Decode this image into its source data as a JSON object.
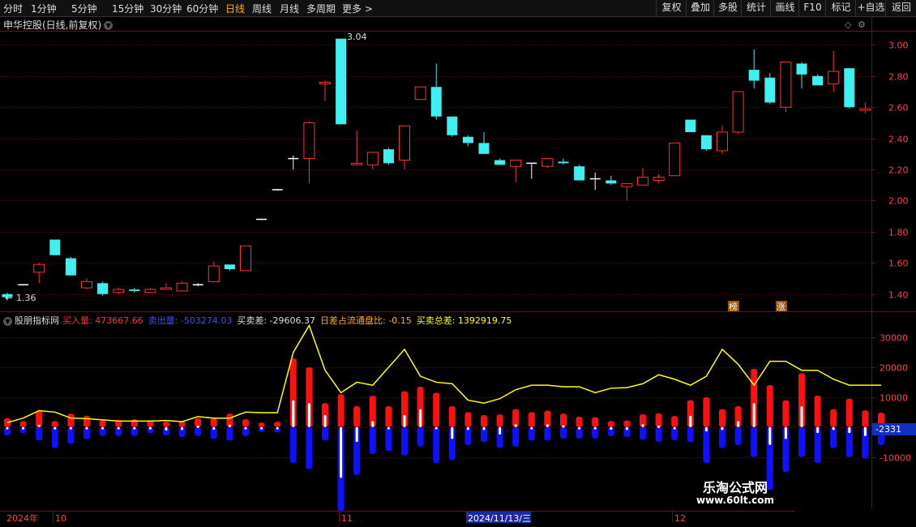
{
  "toolbar": {
    "periods": [
      "分时",
      "1分钟",
      "5分钟",
      "15分钟",
      "30分钟",
      "60分钟",
      "日线",
      "周线",
      "月线",
      "多周期",
      "更多 >"
    ],
    "active_period": "日线",
    "right_buttons": [
      "复权",
      "叠加",
      "多股",
      "统计",
      "画线",
      "F10",
      "标记",
      "+自选",
      "返回"
    ]
  },
  "price_panel": {
    "title": "申华控股(日线,前复权)",
    "high_label": "3.04",
    "low_label": "1.36",
    "low_arrow": "←",
    "markers": [
      "榜",
      "涨"
    ]
  },
  "indicator_panel": {
    "name": "股朋指标网",
    "items": [
      {
        "label": "买入量:",
        "value": "473667.66",
        "color": "#ff3030"
      },
      {
        "label": "卖出量:",
        "value": "-503274.03",
        "color": "#3050ff"
      },
      {
        "label": "买卖差:",
        "value": "-29606.37",
        "color": "#dddddd"
      },
      {
        "label": "日差占流通盘比:",
        "value": "-0.15",
        "color": "#ffb000"
      },
      {
        "label": "买卖总差:",
        "value": "1392919.75",
        "color": "#ffff00"
      }
    ],
    "current_value_label": "-2331"
  },
  "date_axis": {
    "labels": [
      "2024年",
      "10",
      "11",
      "2024/11/13/三",
      "12"
    ]
  },
  "watermark": {
    "line1": "乐淘公式网",
    "line2": "www.60lt.com"
  },
  "chart_data": [
    {
      "type": "candlestick",
      "title": "申华控股(日线,前复权)",
      "y_ticks": [
        3.0,
        2.8,
        2.6,
        2.4,
        2.2,
        2.0,
        1.8,
        1.6,
        1.4
      ],
      "ylim": [
        1.31,
        3.08
      ],
      "candles": [
        [
          1.4,
          1.38,
          1.41,
          1.36
        ],
        [
          1.46,
          1.46,
          1.46,
          1.46
        ],
        [
          1.54,
          1.59,
          1.6,
          1.47
        ],
        [
          1.75,
          1.65,
          1.75,
          1.65
        ],
        [
          1.63,
          1.52,
          1.64,
          1.52
        ],
        [
          1.44,
          1.48,
          1.5,
          1.43
        ],
        [
          1.47,
          1.4,
          1.48,
          1.39
        ],
        [
          1.41,
          1.43,
          1.44,
          1.4
        ],
        [
          1.43,
          1.42,
          1.44,
          1.41
        ],
        [
          1.41,
          1.43,
          1.44,
          1.41
        ],
        [
          1.43,
          1.44,
          1.47,
          1.43
        ],
        [
          1.42,
          1.47,
          1.48,
          1.42
        ],
        [
          1.46,
          1.46,
          1.47,
          1.45
        ],
        [
          1.48,
          1.58,
          1.61,
          1.48
        ],
        [
          1.59,
          1.56,
          1.59,
          1.55
        ],
        [
          1.55,
          1.71,
          1.71,
          1.55
        ],
        [
          1.88,
          1.88,
          1.88,
          1.88
        ],
        [
          2.07,
          2.07,
          2.07,
          2.07
        ],
        [
          2.27,
          2.27,
          2.29,
          2.2
        ],
        [
          2.27,
          2.5,
          2.51,
          2.11
        ],
        [
          2.75,
          2.76,
          2.77,
          2.64
        ],
        [
          3.04,
          2.49,
          3.04,
          2.49
        ],
        [
          2.23,
          2.24,
          2.45,
          2.23
        ],
        [
          2.23,
          2.31,
          2.31,
          2.2
        ],
        [
          2.33,
          2.24,
          2.34,
          2.23
        ],
        [
          2.26,
          2.48,
          2.48,
          2.2
        ],
        [
          2.65,
          2.73,
          2.73,
          2.65
        ],
        [
          2.73,
          2.54,
          2.88,
          2.52
        ],
        [
          2.54,
          2.42,
          2.54,
          2.41
        ],
        [
          2.41,
          2.37,
          2.42,
          2.35
        ],
        [
          2.37,
          2.3,
          2.44,
          2.3
        ],
        [
          2.26,
          2.23,
          2.27,
          2.23
        ],
        [
          2.22,
          2.26,
          2.26,
          2.12
        ],
        [
          2.24,
          2.24,
          2.24,
          2.14
        ],
        [
          2.22,
          2.27,
          2.27,
          2.21
        ],
        [
          2.25,
          2.24,
          2.27,
          2.23
        ],
        [
          2.22,
          2.13,
          2.23,
          2.13
        ],
        [
          2.14,
          2.14,
          2.18,
          2.07
        ],
        [
          2.13,
          2.11,
          2.16,
          2.1
        ],
        [
          2.09,
          2.11,
          2.11,
          2.0
        ],
        [
          2.1,
          2.15,
          2.21,
          2.1
        ],
        [
          2.13,
          2.15,
          2.17,
          2.11
        ],
        [
          2.16,
          2.37,
          2.37,
          2.16
        ],
        [
          2.52,
          2.44,
          2.52,
          2.44
        ],
        [
          2.42,
          2.33,
          2.42,
          2.32
        ],
        [
          2.32,
          2.44,
          2.48,
          2.3
        ],
        [
          2.44,
          2.7,
          2.7,
          2.43
        ],
        [
          2.84,
          2.77,
          2.97,
          2.72
        ],
        [
          2.79,
          2.63,
          2.82,
          2.62
        ],
        [
          2.6,
          2.89,
          2.89,
          2.57
        ],
        [
          2.88,
          2.81,
          2.89,
          2.72
        ],
        [
          2.8,
          2.74,
          2.81,
          2.74
        ],
        [
          2.75,
          2.83,
          2.96,
          2.7
        ],
        [
          2.85,
          2.6,
          2.85,
          2.59
        ],
        [
          2.58,
          2.59,
          2.63,
          2.56
        ]
      ]
    },
    {
      "type": "bar",
      "title": "股朋指标网",
      "y_ticks": [
        30000,
        20000,
        10000,
        -10000
      ],
      "ylim": [
        -28000,
        36000
      ],
      "buy": [
        3000,
        2000,
        5500,
        2000,
        4500,
        3800,
        2200,
        2400,
        2600,
        2200,
        1800,
        2000,
        3000,
        3000,
        4500,
        2600,
        1500,
        1800,
        23000,
        20000,
        8000,
        11000,
        7000,
        10500,
        7000,
        12000,
        13500,
        11500,
        7000,
        5000,
        4000,
        4200,
        6000,
        5000,
        5500,
        4500,
        3500,
        3300,
        2000,
        2200,
        4300,
        4600,
        3700,
        9000,
        10000,
        6000,
        7000,
        19500,
        14000,
        9000,
        18000,
        10500,
        6000,
        9500,
        5600,
        4800
      ],
      "sell": [
        -2800,
        -2000,
        -4500,
        -7000,
        -5600,
        -4000,
        -3000,
        -3000,
        -3000,
        -2000,
        -2800,
        -3300,
        -3000,
        -4000,
        -4500,
        -3000,
        -1500,
        -1800,
        -12000,
        -14000,
        -4500,
        -28000,
        -16000,
        -9000,
        -8000,
        -9500,
        -6500,
        -12000,
        -11000,
        -6000,
        -5000,
        -7000,
        -6500,
        -4500,
        -4500,
        -3800,
        -3800,
        -3800,
        -3000,
        -3300,
        -4200,
        -5000,
        -4400,
        -5000,
        -12000,
        -7000,
        -6000,
        -10000,
        -21000,
        -15000,
        -10000,
        -12000,
        -7000,
        -10000,
        -10500,
        -6000
      ],
      "diff": [
        -500,
        0,
        800,
        -500,
        -800,
        -600,
        -700,
        -800,
        -600,
        -200,
        -1200,
        -1000,
        500,
        -900,
        800,
        -700,
        0,
        0,
        9000,
        8000,
        4000,
        -17000,
        -5000,
        2000,
        0,
        4000,
        6000,
        0,
        -4000,
        -1000,
        -1000,
        -2500,
        1000,
        0,
        1000,
        600,
        -300,
        -500,
        -900,
        -1000,
        1000,
        500,
        -500,
        3800,
        -1500,
        -1000,
        2000,
        8000,
        -6000,
        -4000,
        7000,
        -2000,
        -1000,
        -2000,
        -3000,
        -2331
      ],
      "total": [
        1500,
        3000,
        5500,
        5000,
        3000,
        2800,
        2400,
        2000,
        2000,
        2000,
        2200,
        1800,
        3500,
        3000,
        3000,
        5000,
        4800,
        4800,
        25000,
        34000,
        19000,
        11500,
        15000,
        14000,
        20000,
        26000,
        17000,
        15000,
        14500,
        9000,
        8000,
        9500,
        12500,
        14000,
        14000,
        13500,
        13500,
        11500,
        13000,
        13200,
        14500,
        17500,
        16000,
        14000,
        17000,
        26000,
        21000,
        14000,
        22000,
        22000,
        19000,
        19000,
        16000,
        14000,
        14000,
        14000
      ]
    }
  ]
}
